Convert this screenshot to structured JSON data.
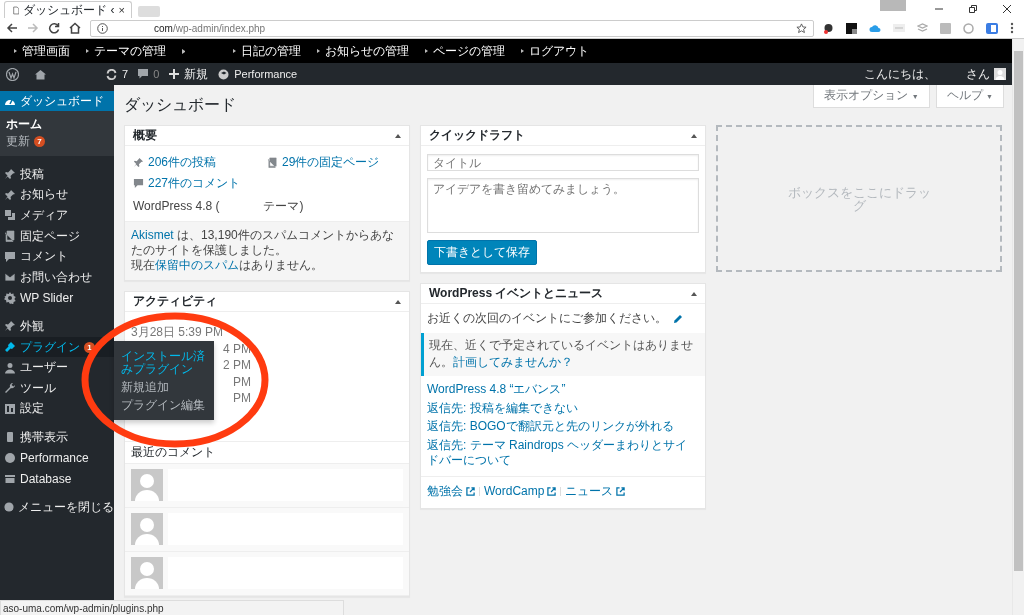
{
  "browser": {
    "tab_title": "ダッシュボード ‹",
    "tab_close": "×",
    "url_host": "com",
    "url_path": "/wp-admin/index.php",
    "status_url": "aso-uma.com/wp-admin/plugins.php"
  },
  "site_bar": {
    "links": [
      "管理画面",
      "テーマの管理",
      "日記の管理",
      "お知らせの管理",
      "ページの管理",
      "ログアウト"
    ]
  },
  "admin_bar": {
    "updates": "7",
    "comments": "0",
    "new": "新規",
    "performance": "Performance",
    "greeting": "こんにちは、",
    "user": "さん"
  },
  "sidebar": {
    "dashboard": {
      "label": "ダッシュボード",
      "selected": true,
      "children": [
        {
          "label": "ホーム",
          "selected": true
        },
        {
          "label": "更新",
          "selected": false,
          "badge": "7"
        }
      ]
    },
    "groups": [
      [
        {
          "label": "投稿",
          "hovered": false
        },
        {
          "label": "お知らせ",
          "hovered": false
        },
        {
          "label": "メディア",
          "hovered": false
        },
        {
          "label": "固定ページ",
          "hovered": false
        },
        {
          "label": "コメント",
          "hovered": false
        },
        {
          "label": "お問い合わせ",
          "hovered": false
        },
        {
          "label": "WP Slider",
          "hovered": false
        }
      ],
      [
        {
          "label": "外観",
          "hovered": false
        },
        {
          "label": "プラグイン",
          "hovered": true,
          "badge": "1",
          "flyout": [
            {
              "label": "インストール済みプラグイン",
              "selected": true
            },
            {
              "label": "新規追加",
              "selected": false
            },
            {
              "label": "プラグイン編集",
              "selected": false
            }
          ]
        },
        {
          "label": "ユーザー",
          "hovered": false
        },
        {
          "label": "ツール",
          "hovered": false
        },
        {
          "label": "設定",
          "hovered": false
        }
      ],
      [
        {
          "label": "携帯表示",
          "hovered": false
        },
        {
          "label": "Performance",
          "hovered": false
        },
        {
          "label": "Database",
          "hovered": false
        }
      ],
      [
        {
          "label": "メニューを閉じる",
          "hovered": false
        }
      ]
    ]
  },
  "page": {
    "title": "ダッシュボード",
    "screen_options": {
      "label": "表示オプション",
      "caret": "▼"
    },
    "help": {
      "label": "ヘルプ",
      "caret": "▼"
    }
  },
  "overview": {
    "title": "概要",
    "stats": [
      "206件の投稿",
      "29件の固定ページ",
      "227件のコメント"
    ],
    "version": "WordPress 4.8 (",
    "theme": "テーマ)",
    "akismet": [
      [
        {
          "text": "Akismet",
          "link": true
        },
        {
          "text": " は、13,190件のスパムコメントからあなたのサイトを保護しました。",
          "link": false
        }
      ],
      [
        {
          "text": "現在",
          "link": false
        },
        {
          "text": "保留中のスパム",
          "link": true
        },
        {
          "text": "はありません。",
          "link": false
        }
      ]
    ]
  },
  "activity": {
    "title": "アクティビティ",
    "first": "3月28日 5:39 PM",
    "fragments": [
      "4 PM",
      "2 PM",
      "PM",
      "PM"
    ],
    "comments_heading": "最近のコメント",
    "comments": [
      {
        "kind": "comment"
      },
      {
        "kind": "comment"
      },
      {
        "kind": "comment"
      }
    ]
  },
  "quick_draft": {
    "title": "クイックドラフト",
    "title_placeholder": "タイトル",
    "content_placeholder": "アイデアを書き留めてみましょう。",
    "button": "下書きとして保存"
  },
  "events": {
    "title": "WordPress イベントとニュース",
    "intro": "お近くの次回のイベントにご参加ください。",
    "notice": "現在、近くで予定されているイベントはありません。",
    "notice_link": "計画してみませんか？",
    "news": [
      "WordPress 4.8 “エバンス”",
      "返信先: 投稿を編集できない",
      "返信先: BOGOで翻訳元と先のリンクが外れる",
      "返信先: テーマ Raindrops ヘッダーまわりとサイドバーについて"
    ],
    "footer": [
      "勉強会",
      "WordCamp",
      "ニュース"
    ]
  },
  "dropzone": {
    "text": "ボックスをここにドラッグ"
  }
}
